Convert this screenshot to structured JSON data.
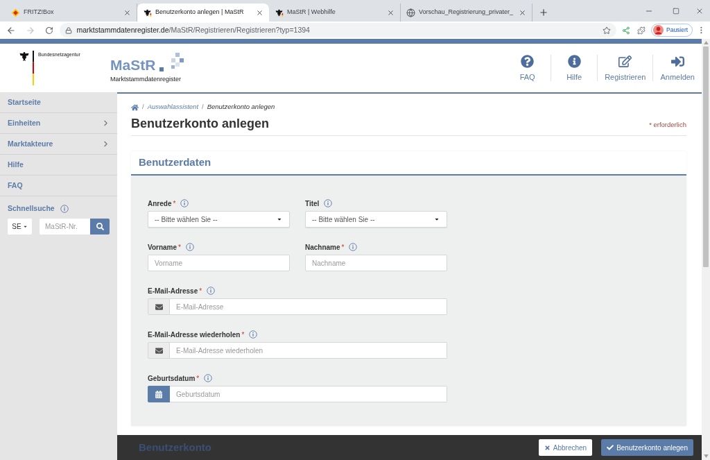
{
  "browser": {
    "tabs": [
      {
        "title": "FRITZ!Box",
        "kind": "fritz",
        "selected": false
      },
      {
        "title": "Benutzerkonto anlegen | MaStR",
        "kind": "agency",
        "selected": true
      },
      {
        "title": "MaStR | Webhilfe",
        "kind": "agency",
        "selected": false
      },
      {
        "title": "Vorschau_Registrierung_privater_",
        "kind": "web",
        "selected": false
      }
    ],
    "address": {
      "host": "marktstammdatenregister.de",
      "path": "/MaStR/Registrieren/Registrieren?typ=1394"
    },
    "profile": "Pausiert"
  },
  "header": {
    "agency": "Bundesnetzagentur",
    "logo_name": "MaStR",
    "logo_subtitle": "Marktstammdatenregister",
    "nav": [
      {
        "label": "FAQ",
        "kind": "faq"
      },
      {
        "label": "Hilfe",
        "kind": "help"
      },
      {
        "label": "Registrieren",
        "kind": "register"
      },
      {
        "label": "Anmelden",
        "kind": "login"
      }
    ]
  },
  "sidebar": {
    "items": [
      {
        "label": "Startseite",
        "has_submenu": false
      },
      {
        "label": "Einheiten",
        "has_submenu": true
      },
      {
        "label": "Marktakteure",
        "has_submenu": true
      },
      {
        "label": "Hilfe",
        "has_submenu": false
      },
      {
        "label": "FAQ",
        "has_submenu": false
      }
    ],
    "quick_search": {
      "label": "Schnellsuche",
      "type": "SE",
      "placeholder": "MaStR-Nr."
    }
  },
  "breadcrumb": {
    "separator": "/",
    "items": [
      {
        "label": "Auswahlassistent",
        "current": false
      },
      {
        "label": "Benutzerkonto anlegen",
        "current": true
      }
    ]
  },
  "page": {
    "title": "Benutzerkonto anlegen",
    "required_note": "* erforderlich"
  },
  "form": {
    "section": "Benutzerdaten",
    "required_marker": "*",
    "rows": [
      {
        "fields": [
          {
            "label": "Anrede",
            "required": true,
            "kind": "select",
            "value": "-- Bitte wählen Sie --"
          },
          {
            "label": "Titel",
            "required": false,
            "kind": "select",
            "value": "-- Bitte wählen Sie --"
          }
        ]
      },
      {
        "fields": [
          {
            "label": "Vorname",
            "required": true,
            "kind": "text",
            "placeholder": "Vorname"
          },
          {
            "label": "Nachname",
            "required": true,
            "kind": "text",
            "placeholder": "Nachname"
          }
        ]
      },
      {
        "fields": [
          {
            "label": "E-Mail-Adresse",
            "required": true,
            "kind": "email",
            "placeholder": "E-Mail-Adresse"
          }
        ]
      },
      {
        "fields": [
          {
            "label": "E-Mail-Adresse wiederholen",
            "required": true,
            "kind": "email",
            "placeholder": "E-Mail-Adresse wiederholen"
          }
        ]
      },
      {
        "fields": [
          {
            "label": "Geburtsdatum",
            "required": true,
            "kind": "date",
            "placeholder": "Geburtsdatum"
          }
        ]
      }
    ],
    "next_section": "Benutzerkonto"
  },
  "actions": [
    {
      "label": "Abbrechen",
      "kind": "cancel"
    },
    {
      "label": "Benutzerkonto anlegen",
      "kind": "submit"
    }
  ]
}
